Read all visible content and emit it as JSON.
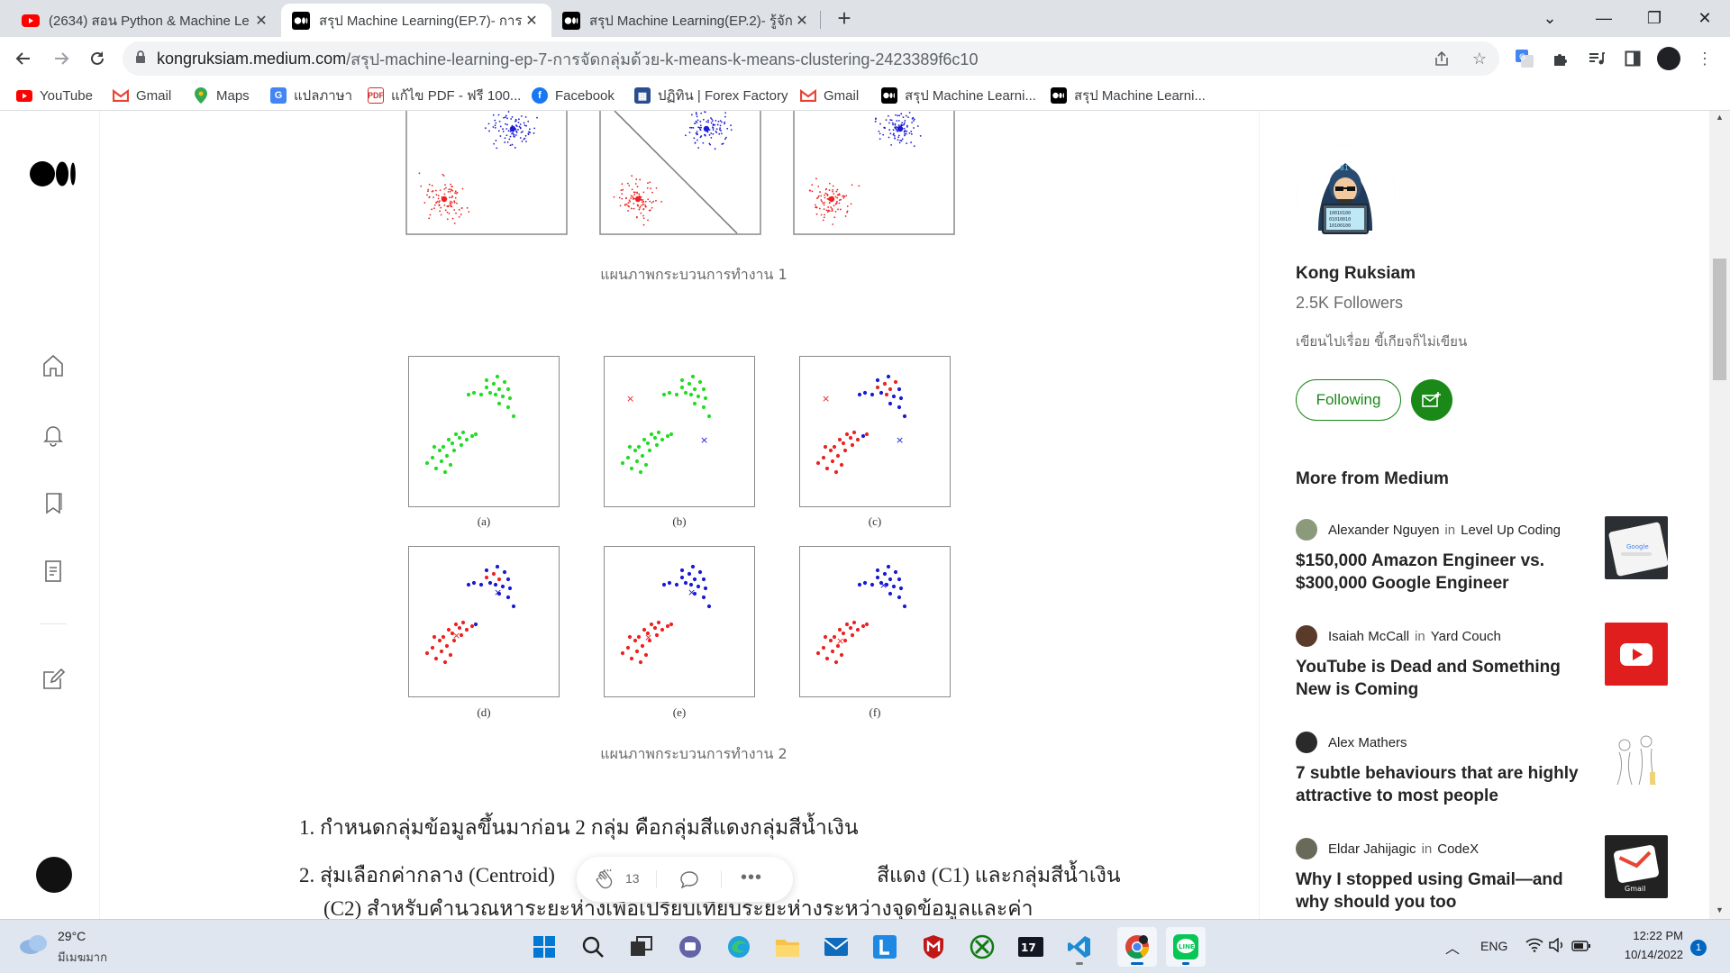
{
  "browser": {
    "tabs": [
      {
        "label": "(2634) สอน Python & Machine Le",
        "favicon": "youtube-icon",
        "active": false
      },
      {
        "label": "สรุป Machine Learning(EP.7)- การ",
        "favicon": "medium-icon",
        "active": true
      },
      {
        "label": "สรุป Machine Learning(EP.2)- รู้จัก",
        "favicon": "medium-icon",
        "active": false
      }
    ],
    "new_tab": "+",
    "url_host": "kongruksiam.medium.com",
    "url_path": "/สรุป-machine-learning-ep-7-การจัดกลุ่มด้วย-k-means-k-means-clustering-2423389f6c10",
    "bookmarks": [
      {
        "label": "YouTube",
        "icon": "youtube-icon",
        "color": "#ff0000"
      },
      {
        "label": "Gmail",
        "icon": "gmail-icon",
        "color": "#ea4335"
      },
      {
        "label": "Maps",
        "icon": "maps-icon",
        "color": "#34a853"
      },
      {
        "label": "แปลภาษา",
        "icon": "translate-icon",
        "color": "#4285f4"
      },
      {
        "label": "แก้ไข PDF - ฟรี 100...",
        "icon": "pdf-icon",
        "color": "#d32f2f"
      },
      {
        "label": "Facebook",
        "icon": "facebook-icon",
        "color": "#1877f2"
      },
      {
        "label": "ปฏิทิน | Forex Factory",
        "icon": "calendar-icon",
        "color": "#2a4d8f"
      },
      {
        "label": "Gmail",
        "icon": "gmail-icon",
        "color": "#ea4335"
      },
      {
        "label": "สรุป Machine Learni...",
        "icon": "medium-icon",
        "color": "#000000"
      },
      {
        "label": "สรุป Machine Learni...",
        "icon": "medium-icon",
        "color": "#000000"
      }
    ]
  },
  "article": {
    "caption1": "แผนภาพกระบวนการทำงาน 1",
    "caption2": "แผนภาพกระบวนการทำงาน 2",
    "panel_labels": [
      "(a)",
      "(b)",
      "(c)",
      "(d)",
      "(e)",
      "(f)"
    ],
    "list_item_1": "1. กำหนดกลุ่มข้อมูลขึ้นมาก่อน 2 กลุ่ม คือกลุ่มสีแดงกลุ่มสีน้ำเงิน",
    "list_item_2a": "2. สุ่มเลือกค่ากลาง (Centroid)",
    "list_item_2b": "สีแดง (C1) และกลุ่มสีน้ำเงิน",
    "list_item_2c": "(C2) สำหรับคำนวณหาระยะห่างเพื่อเปรียบเทียบระยะห่างระหว่างจุดข้อมูลและค่า",
    "clap_count": "13",
    "colors": {
      "red": "#ee2222",
      "blue": "#1a1ad6",
      "green": "#22dd22"
    }
  },
  "author": {
    "name": "Kong Ruksiam",
    "followers": "2.5K Followers",
    "bio": "เขียนไปเรื่อย ขี้เกียจก็ไม่เขียน",
    "follow_label": "Following",
    "accent": "#1a8917",
    "avatar_text": "01",
    "avatar_screen": [
      "10010100",
      "01010010",
      "10100100"
    ]
  },
  "more": {
    "heading": "More from Medium",
    "stories": [
      {
        "author": "Alexander Nguyen",
        "in": "in",
        "pub": "Level Up Coding",
        "title": "$150,000 Amazon Engineer vs. $300,000 Google Engineer",
        "thumb": "google-phone-thumb"
      },
      {
        "author": "Isaiah McCall",
        "in": "in",
        "pub": "Yard Couch",
        "title": "YouTube is Dead and Something New is Coming",
        "thumb": "youtube-logo-thumb"
      },
      {
        "author": "Alex Mathers",
        "in": "",
        "pub": "",
        "title": "7 subtle behaviours that are highly attractive to most people",
        "thumb": "sketch-people-thumb"
      },
      {
        "author": "Eldar Jahijagic",
        "in": "in",
        "pub": "CodeX",
        "title": "Why I stopped using Gmail—and why should you too",
        "thumb": "gmail-thumb"
      }
    ]
  },
  "taskbar": {
    "weather_temp": "29°C",
    "weather_desc": "มีเมฆมาก",
    "lang": "ENG",
    "time": "12:22 PM",
    "date": "10/14/2022",
    "notif_count": "1"
  }
}
